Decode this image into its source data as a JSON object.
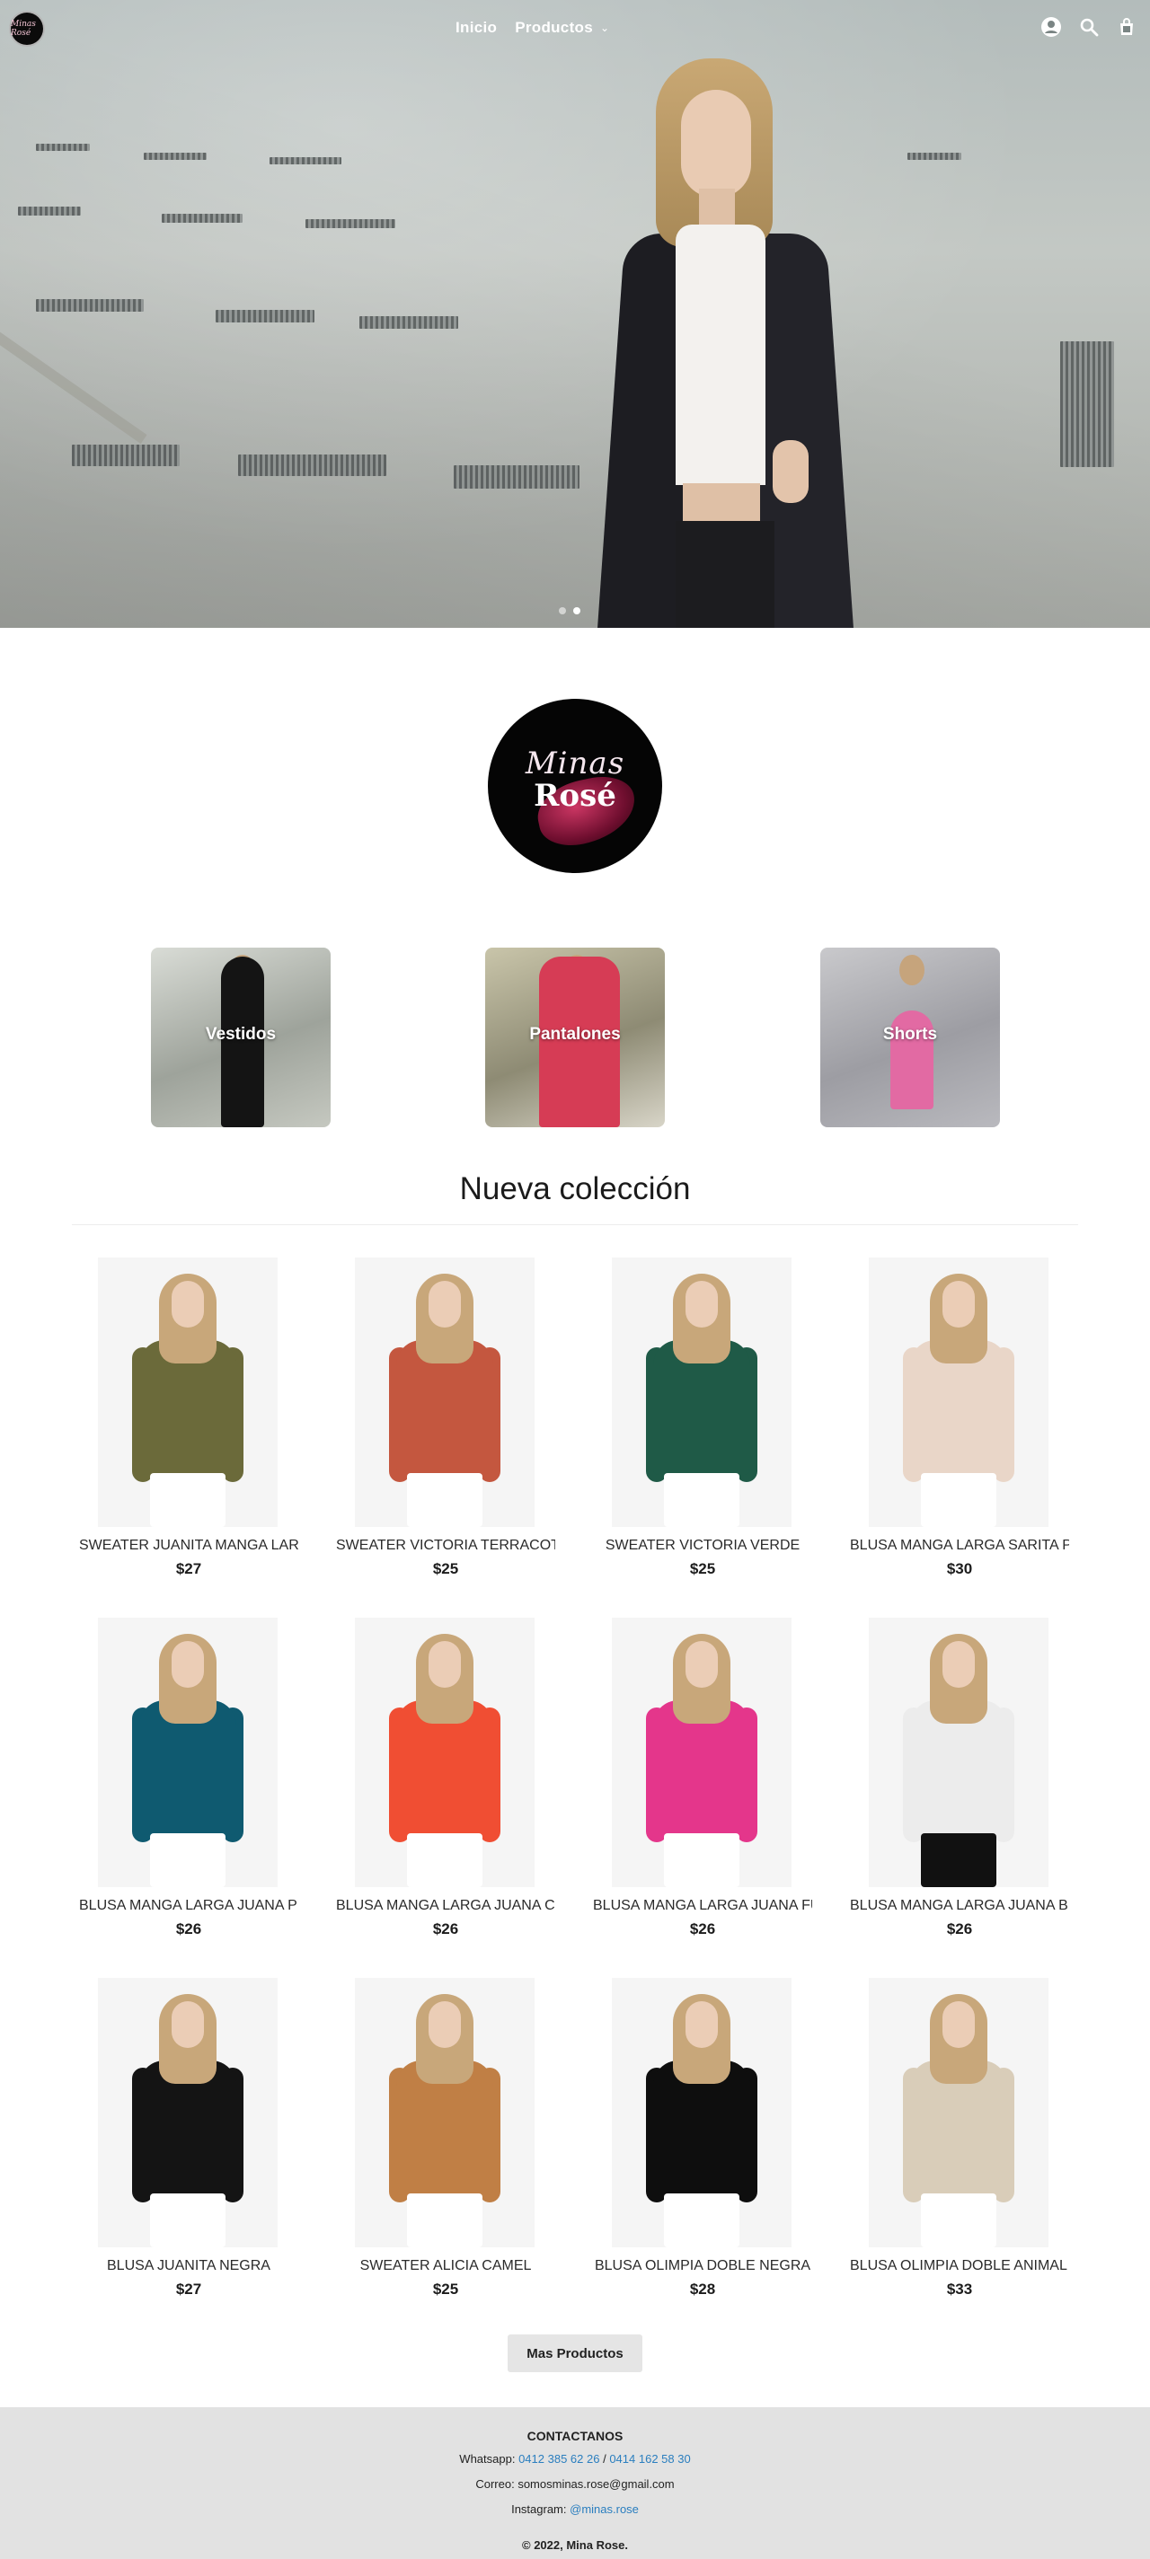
{
  "nav": {
    "logo_text": "Minas Rosé",
    "links": [
      {
        "label": "Inicio"
      },
      {
        "label": "Productos"
      }
    ],
    "icons": [
      "account-icon",
      "search-icon",
      "cart-icon"
    ]
  },
  "hero": {
    "slides": 2,
    "active_slide": 2
  },
  "brand": {
    "script": "Minas",
    "word": "Rosé"
  },
  "categories": [
    {
      "label": "Vestidos"
    },
    {
      "label": "Pantalones"
    },
    {
      "label": "Shorts"
    }
  ],
  "section": {
    "title": "Nueva colección"
  },
  "products": [
    {
      "name": "SWEATER JUANITA MANGA LARGA",
      "price": "$27",
      "color": "#6b6a3a"
    },
    {
      "name": "SWEATER VICTORIA TERRACOTA",
      "price": "$25",
      "color": "#c4573f"
    },
    {
      "name": "SWEATER VICTORIA VERDE",
      "price": "$25",
      "color": "#1f5a47"
    },
    {
      "name": "BLUSA MANGA LARGA SARITA PRINT",
      "price": "$30",
      "color": "#e9d6c8"
    },
    {
      "name": "BLUSA MANGA LARGA JUANA PETRÓLEO",
      "price": "$26",
      "color": "#0f5a70"
    },
    {
      "name": "BLUSA MANGA LARGA JUANA CORAL",
      "price": "$26",
      "color": "#f04e33"
    },
    {
      "name": "BLUSA MANGA LARGA JUANA FUCSIA",
      "price": "$26",
      "color": "#e4368b"
    },
    {
      "name": "BLUSA MANGA LARGA JUANA BLANCA",
      "price": "$26",
      "color": "#ececec"
    },
    {
      "name": "BLUSA JUANITA NEGRA",
      "price": "$27",
      "color": "#141414"
    },
    {
      "name": "SWEATER ALICIA CAMEL",
      "price": "$25",
      "color": "#c07f45"
    },
    {
      "name": "BLUSA OLIMPIA DOBLE NEGRA",
      "price": "$28",
      "color": "#0e0e0e"
    },
    {
      "name": "BLUSA OLIMPIA DOBLE ANIMAL PRINT",
      "price": "$33",
      "color": "#d9cdb9"
    }
  ],
  "more_button": "Mas Productos",
  "footer": {
    "heading": "CONTACTANOS",
    "whatsapp_label": "Whatsapp:",
    "whatsapp_1": "0412 385 62 26",
    "whatsapp_sep": "/",
    "whatsapp_2": "0414 162 58 30",
    "email_line": "Correo: somosminas.rose@gmail.com",
    "instagram_label": "Instagram:",
    "instagram_handle": "@minas.rose",
    "copyright": "© 2022, Mina Rose."
  }
}
